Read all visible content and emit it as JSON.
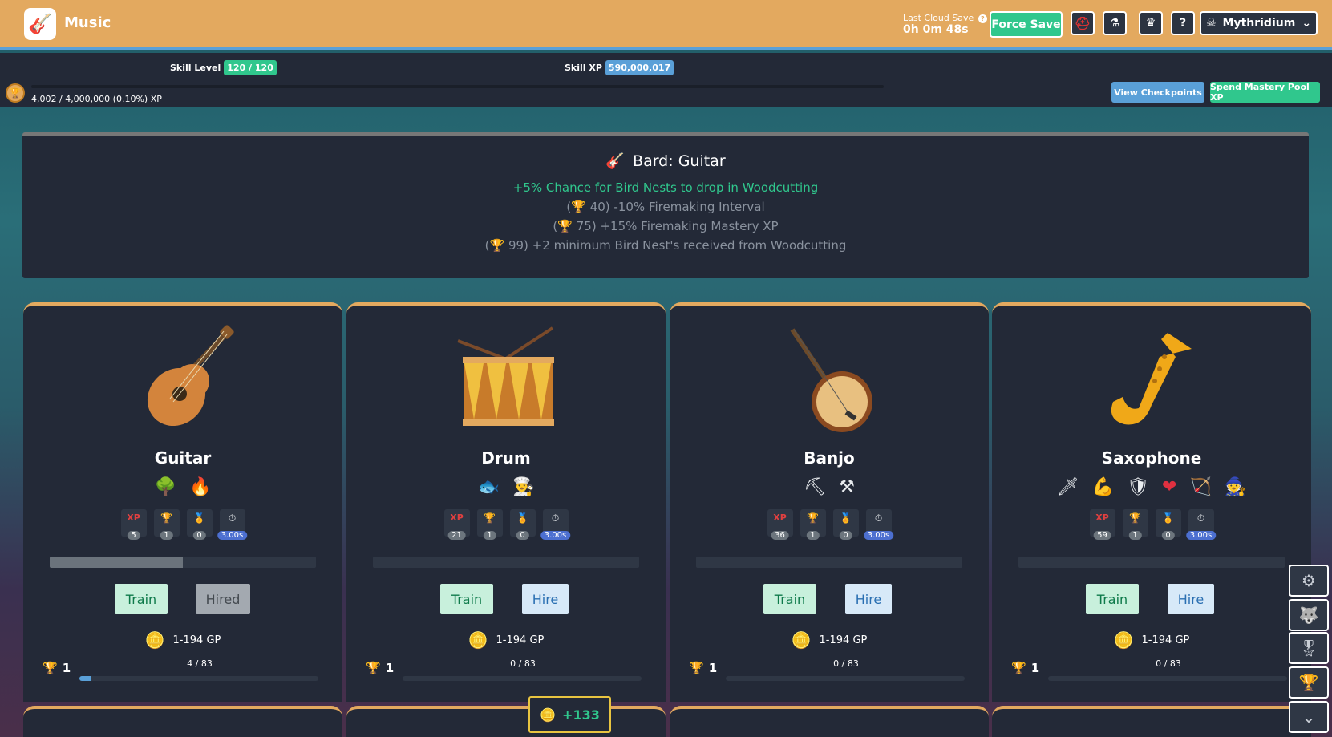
{
  "header": {
    "title": "Music",
    "cloud_save_label": "Last Cloud Save",
    "cloud_save_time": "0h 0m 48s",
    "force_save": "Force Save",
    "help": "?",
    "account_name": "Mythridium"
  },
  "skill": {
    "level_label": "Skill Level",
    "level_value": "120 / 120",
    "xp_label": "Skill XP",
    "xp_value": "590,000,017",
    "mastery_pool_text": "4,002 / 4,000,000 (0.10%) XP",
    "view_checkpoints": "View Checkpoints",
    "spend_pool": "Spend Mastery Pool XP"
  },
  "bard": {
    "title": "Bard: Guitar",
    "bonus": "+5% Chance for Bird Nests to drop in Woodcutting",
    "milestones": [
      {
        "prefix": "(",
        "level": "40)",
        "text": "-10% Firemaking Interval"
      },
      {
        "prefix": "(",
        "level": "75)",
        "text": "+15% Firemaking Mastery XP"
      },
      {
        "prefix": "(",
        "level": "99)",
        "text": "+2 minimum Bird Nest's received from Woodcutting"
      }
    ]
  },
  "cards": [
    {
      "name": "Guitar",
      "xp": "5",
      "mastery": "1",
      "pool": "0",
      "time": "3.00s",
      "train": "Train",
      "hire": "Hired",
      "gp": "1-194 GP",
      "mastery_level": "1",
      "mastery_progress": "4 / 83",
      "progress_fraction": 0.5,
      "mastery_fraction": 0.05,
      "hired": true
    },
    {
      "name": "Drum",
      "xp": "21",
      "mastery": "1",
      "pool": "0",
      "time": "3.00s",
      "train": "Train",
      "hire": "Hire",
      "gp": "1-194 GP",
      "mastery_level": "1",
      "mastery_progress": "0 / 83",
      "progress_fraction": 0,
      "mastery_fraction": 0,
      "hired": false
    },
    {
      "name": "Banjo",
      "xp": "36",
      "mastery": "1",
      "pool": "0",
      "time": "3.00s",
      "train": "Train",
      "hire": "Hire",
      "gp": "1-194 GP",
      "mastery_level": "1",
      "mastery_progress": "0 / 83",
      "progress_fraction": 0,
      "mastery_fraction": 0,
      "hired": false
    },
    {
      "name": "Saxophone",
      "xp": "59",
      "mastery": "1",
      "pool": "0",
      "time": "3.00s",
      "train": "Train",
      "hire": "Hire",
      "gp": "1-194 GP",
      "mastery_level": "1",
      "mastery_progress": "0 / 83",
      "progress_fraction": 0,
      "mastery_fraction": 0,
      "hired": false
    }
  ],
  "stat_xp_label": "XP",
  "popup": {
    "gp_gain": "+133"
  },
  "colors": {
    "header": "#e3a95f",
    "panel": "#232937",
    "accent_green": "#30c78d",
    "accent_blue": "#5aa0d8"
  }
}
